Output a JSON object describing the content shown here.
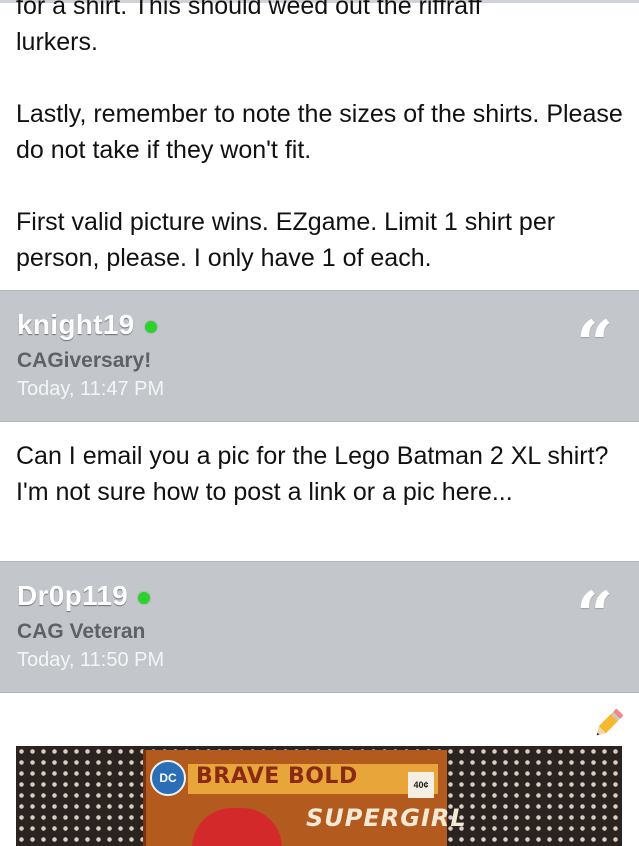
{
  "posts": [
    {
      "body": [
        "for a shirt. This should weed out the riffraff",
        "lurkers.",
        "Lastly, remember to note the sizes of the shirts. Please do not take if they won't fit.",
        "First valid picture wins. EZgame. Limit 1 shirt per person, please. I only have 1 of each."
      ]
    },
    {
      "username": "knight19",
      "user_title": "CAGiversary!",
      "timestamp": "Today, 11:47 PM",
      "body": "Can I email you a pic for the Lego Batman 2 XL shirt? I'm not sure how to post a link or a pic here..."
    },
    {
      "username": "Dr0p119",
      "user_title": "CAG Veteran",
      "timestamp": "Today, 11:50 PM",
      "photo": {
        "logo": "DC",
        "title": "BRAVE BOLD",
        "subtitle": "SUPERGIRL",
        "price": "40¢"
      }
    }
  ],
  "icons": {
    "quote": "quote-icon",
    "edit": "pencil-icon",
    "online": "online-status-icon"
  },
  "colors": {
    "header_bg": "#c3c7cc",
    "online": "#2bd22b",
    "username": "#ffffff",
    "user_title": "#5e6166"
  }
}
